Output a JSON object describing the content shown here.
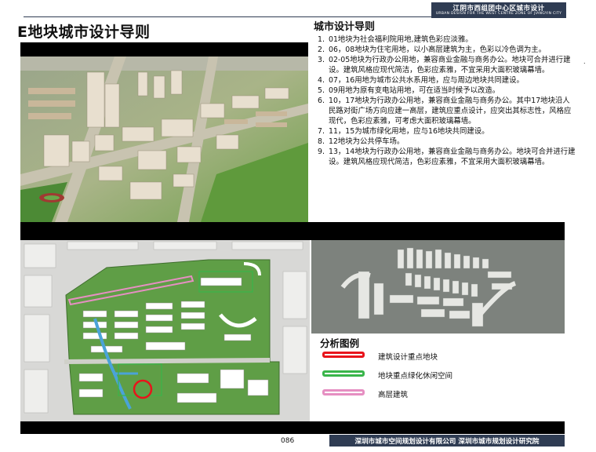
{
  "header": {
    "title": "江阴市西组团中心区城市设计",
    "subtitle": "URBAN DESIGN FOR THE WEST CENTRE ZONE OF JIANGYIN CITY"
  },
  "page_title": "E地块城市设计导则",
  "guidelines": {
    "title": "城市设计导则",
    "items": [
      {
        "num": "1.",
        "text": "01地块为社会福利院用地,建筑色彩应淡雅。"
      },
      {
        "num": "2.",
        "text": "06，08地块为住宅用地，以小高层建筑为主，色彩以冷色调为主。"
      },
      {
        "num": "3.",
        "text": "02-05地块为行政办公用地，兼容商业金融与商务办公。地块可合并进行建设。建筑风格应现代简洁，色彩应素雅，不宜采用大面积玻璃幕墙。"
      },
      {
        "num": "4.",
        "text": "07，16用地为城市公共水系用地，应与周边地块共同建设。"
      },
      {
        "num": "5.",
        "text": "09用地为原有变电站用地，可在适当时候予以改造。"
      },
      {
        "num": "6.",
        "text": "10，17地块为行政办公用地，兼容商业金融与商务办公。其中17地块沿人民路对街广场方向应建一高层，建筑应重点设计，应突出其标志性，风格应现代，色彩应素雅，可考虑大面积玻璃幕墙。"
      },
      {
        "num": "7.",
        "text": "11，15为城市绿化用地，应与16地块共同建设。"
      },
      {
        "num": "8.",
        "text": "12地块为公共停车场。"
      },
      {
        "num": "9.",
        "text": "13，14地块为行政办公用地，兼容商业金融与商务办公。地块可合并进行建设。建筑风格应现代简洁，色彩应素雅，不宜采用大面积玻璃幕墙。"
      }
    ]
  },
  "legend": {
    "title": "分析图例",
    "items": [
      {
        "label": "建筑设计重点地块",
        "color": "#e8141b"
      },
      {
        "label": "地块重点绿化休闲空间",
        "color": "#39b54a"
      },
      {
        "label": "高层建筑",
        "color": "#e68fc2"
      }
    ]
  },
  "page_number": "086",
  "footer": "深圳市城市空间规划设计有限公司  深圳市城市规划设计研究院",
  "colors": {
    "navy": "#2f3c53",
    "band": "#000000",
    "focus_red": "#e8141b",
    "green_space": "#39b54a",
    "high_rise_pink": "#e68fc2"
  }
}
